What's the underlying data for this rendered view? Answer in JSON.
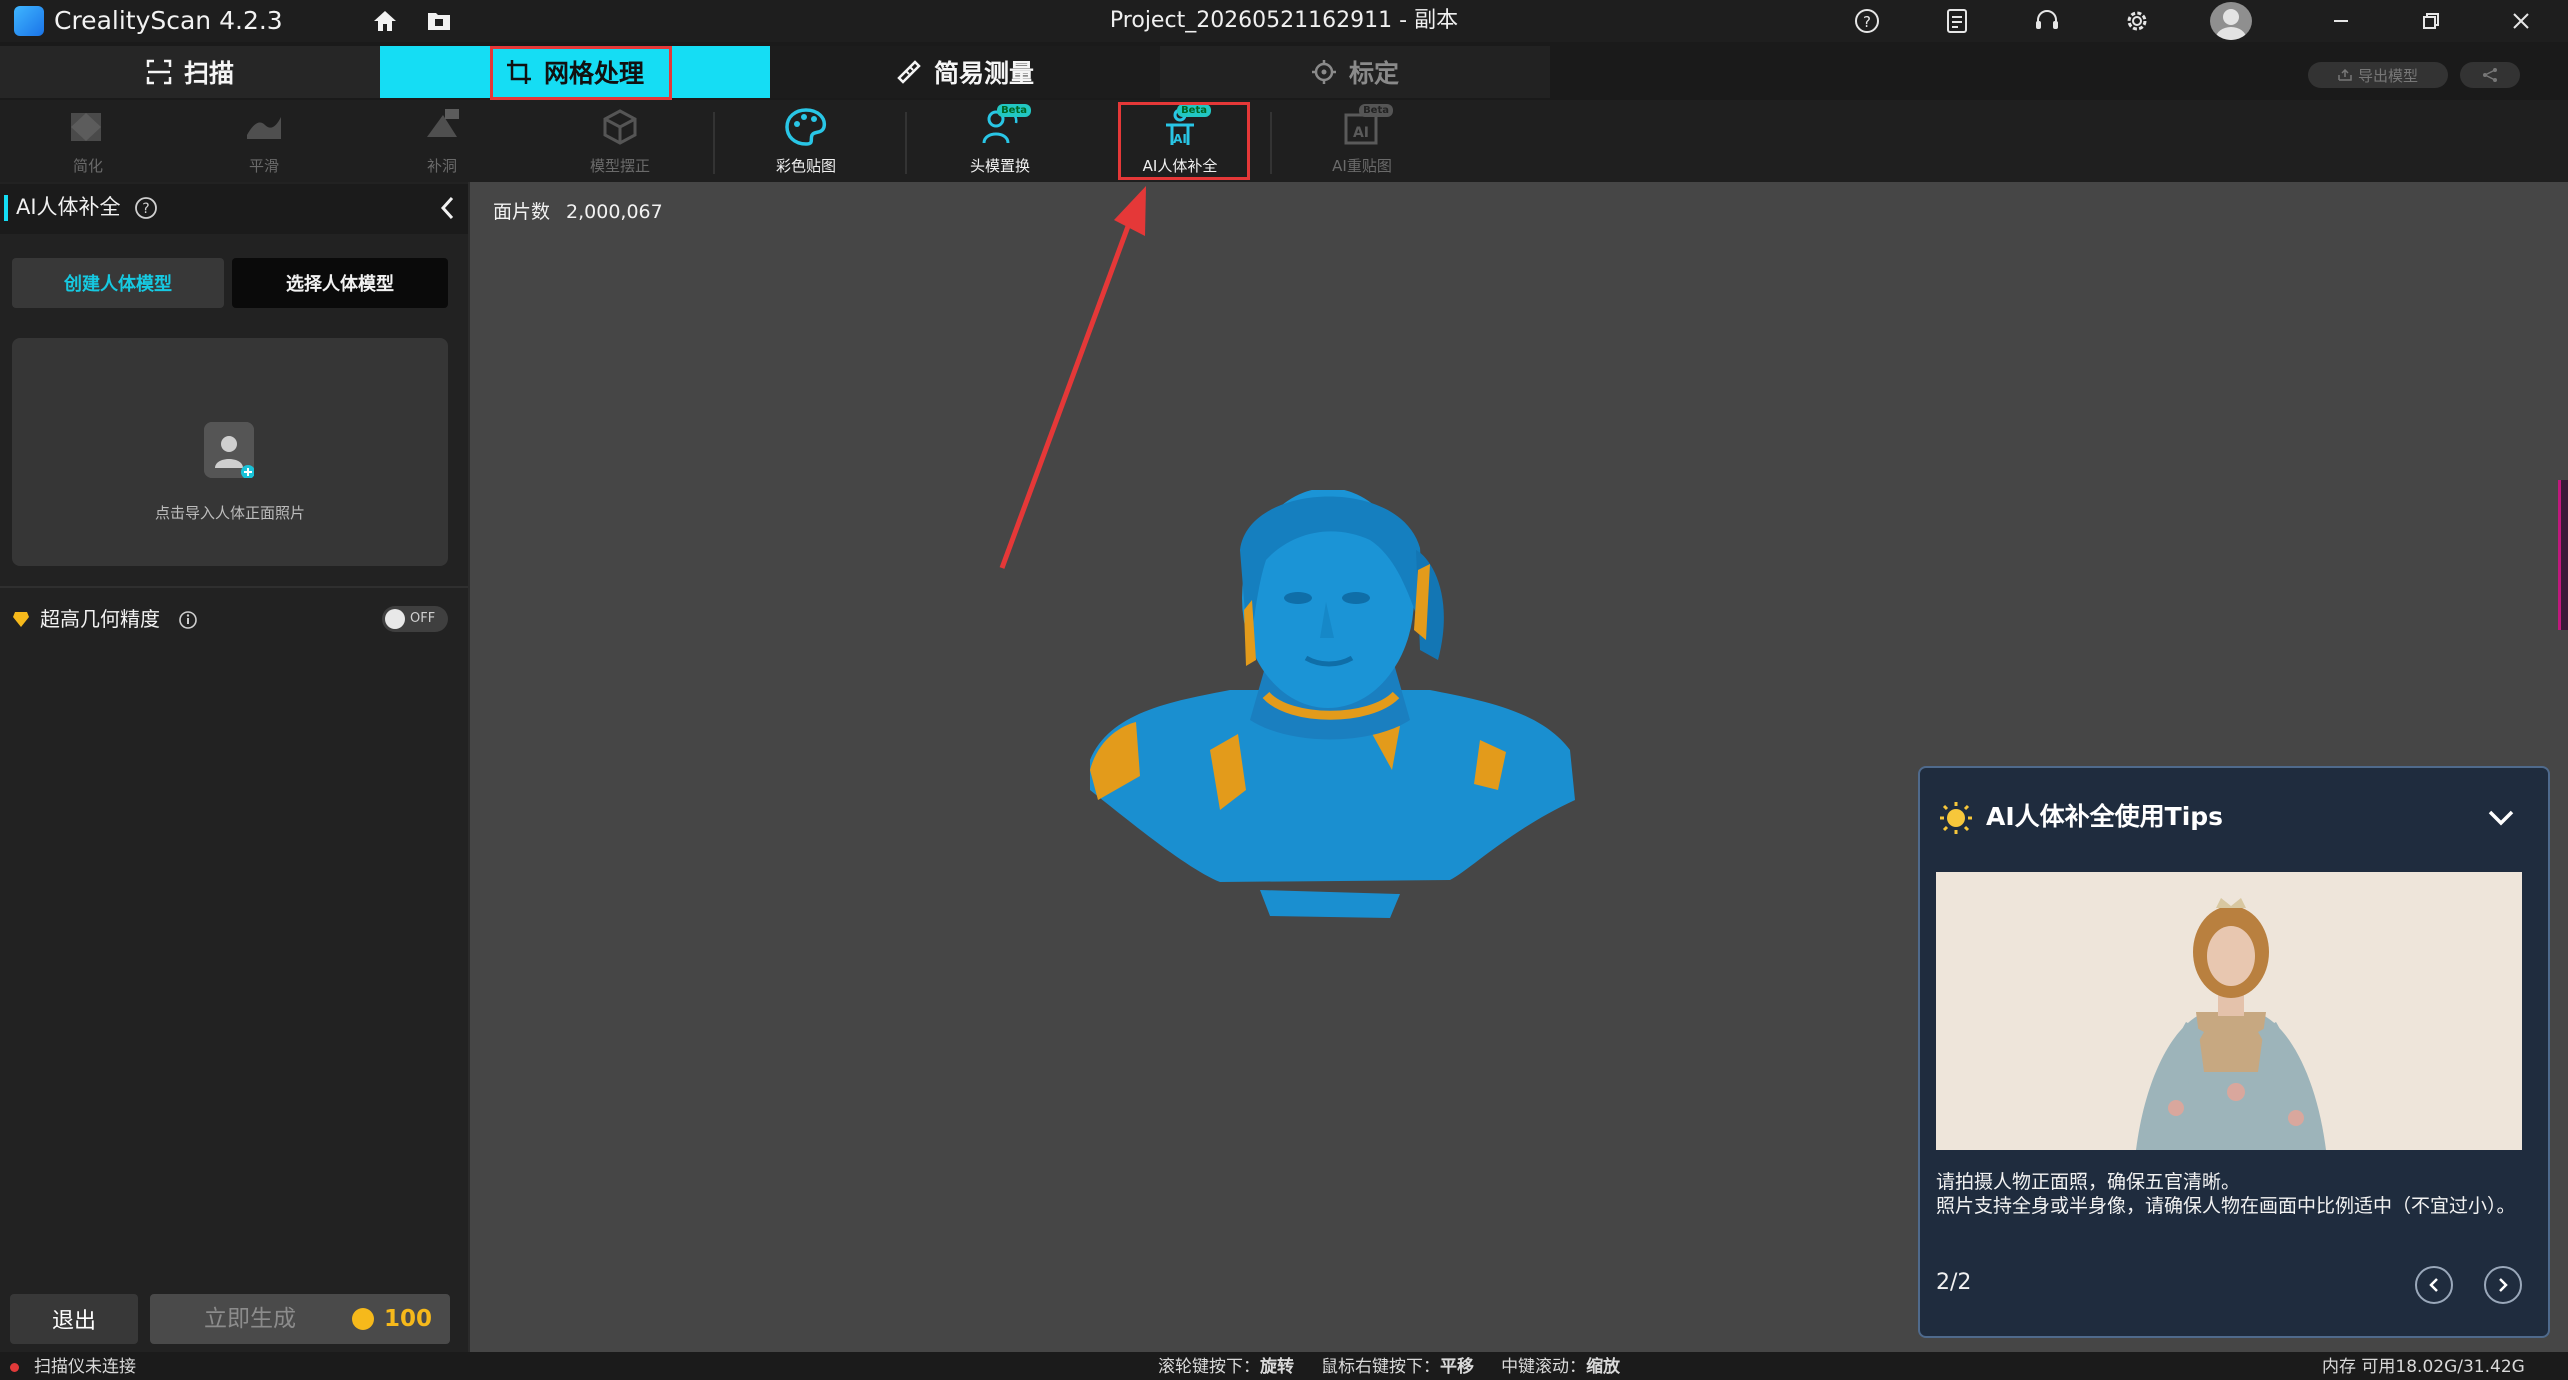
{
  "app": {
    "title": "CrealityScan 4.2.3",
    "project": "Project_20260521162911 - 副本"
  },
  "tabs": {
    "scan": "扫描",
    "mesh": "网格处理",
    "measure": "简易测量",
    "calibrate": "标定"
  },
  "header_actions": {
    "export": "导出模型"
  },
  "tools": [
    {
      "label": "简化",
      "icon": "simplify-icon"
    },
    {
      "label": "平滑",
      "icon": "smooth-icon"
    },
    {
      "label": "补洞",
      "icon": "fill-hole-icon"
    },
    {
      "label": "模型摆正",
      "icon": "align-model-icon"
    },
    {
      "label": "彩色贴图",
      "icon": "color-texture-icon"
    },
    {
      "label": "头模置换",
      "icon": "head-swap-icon",
      "badge": "Beta"
    },
    {
      "label": "AI人体补全",
      "icon": "ai-body-completion-icon",
      "badge": "Beta"
    },
    {
      "label": "AI重贴图",
      "icon": "ai-retexture-icon",
      "badge": "Beta"
    }
  ],
  "panel": {
    "title": "AI人体补全",
    "create_tab": "创建人体模型",
    "select_tab": "选择人体模型",
    "upload_hint": "点击导入人体正面照片",
    "high_precision_label": "超高几何精度",
    "toggle_state": "OFF",
    "exit_button": "退出",
    "generate_button": "立即生成",
    "generate_cost": "100"
  },
  "viewport": {
    "face_count_label": "面片数",
    "face_count_value": "2,000,067"
  },
  "tips": {
    "title": "AI人体补全使用Tips",
    "text_line1": "请拍摄人物正面照，确保五官清晰。",
    "text_line2": "照片支持全身或半身像，请确保人物在画面中比例适中（不宜过小）。",
    "page": "2/2"
  },
  "status": {
    "scanner": "扫描仪未连接",
    "hint_rotate_key": "滚轮键按下：",
    "hint_rotate": "旋转",
    "hint_pan_key": "鼠标右键按下：",
    "hint_pan": "平移",
    "hint_zoom_key": "中键滚动：",
    "hint_zoom": "缩放",
    "memory": "内存 可用18.02G/31.42G"
  },
  "colors": {
    "accent": "#15ddf4",
    "highlight_box": "#e53838",
    "model_blue": "#1a8fd0",
    "model_orange": "#e39b1b",
    "coin": "#f6b91b"
  }
}
